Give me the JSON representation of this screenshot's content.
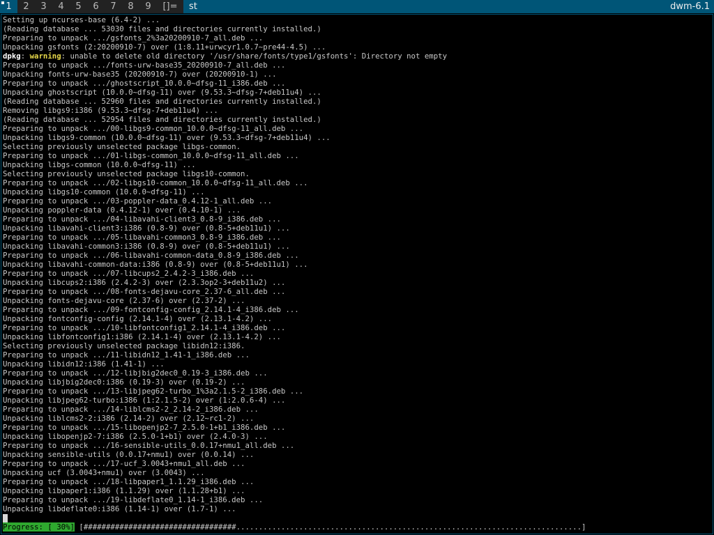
{
  "bar": {
    "tags": [
      "1",
      "2",
      "3",
      "4",
      "5",
      "6",
      "7",
      "8",
      "9"
    ],
    "selected_tag": 0,
    "layout_symbol": "[]=",
    "window_title": "st",
    "status_text": "dwm-6.1"
  },
  "terminal": {
    "lines": [
      {
        "text": "Setting up ncurses-base (6.4-2) ..."
      },
      {
        "text": "(Reading database ... 53030 files and directories currently installed.)"
      },
      {
        "text": "Preparing to unpack .../gsfonts_2%3a20200910-7_all.deb ..."
      },
      {
        "text": "Unpacking gsfonts (2:20200910-7) over (1:8.11+urwcyr1.0.7~pre44-4.5) ..."
      },
      {
        "text": ": unable to delete old directory '/usr/share/fonts/type1/gsfonts': Directory not empty",
        "prefix": "dpkg",
        "warn": "warning"
      },
      {
        "text": "Preparing to unpack .../fonts-urw-base35_20200910-7_all.deb ..."
      },
      {
        "text": "Unpacking fonts-urw-base35 (20200910-7) over (20200910-1) ..."
      },
      {
        "text": "Preparing to unpack .../ghostscript_10.0.0~dfsg-11_i386.deb ..."
      },
      {
        "text": "Unpacking ghostscript (10.0.0~dfsg-11) over (9.53.3~dfsg-7+deb11u4) ..."
      },
      {
        "text": "(Reading database ... 52960 files and directories currently installed.)"
      },
      {
        "text": "Removing libgs9:i386 (9.53.3~dfsg-7+deb11u4) ..."
      },
      {
        "text": "(Reading database ... 52954 files and directories currently installed.)"
      },
      {
        "text": "Preparing to unpack .../00-libgs9-common_10.0.0~dfsg-11_all.deb ..."
      },
      {
        "text": "Unpacking libgs9-common (10.0.0~dfsg-11) over (9.53.3~dfsg-7+deb11u4) ..."
      },
      {
        "text": "Selecting previously unselected package libgs-common."
      },
      {
        "text": "Preparing to unpack .../01-libgs-common_10.0.0~dfsg-11_all.deb ..."
      },
      {
        "text": "Unpacking libgs-common (10.0.0~dfsg-11) ..."
      },
      {
        "text": "Selecting previously unselected package libgs10-common."
      },
      {
        "text": "Preparing to unpack .../02-libgs10-common_10.0.0~dfsg-11_all.deb ..."
      },
      {
        "text": "Unpacking libgs10-common (10.0.0~dfsg-11) ..."
      },
      {
        "text": "Preparing to unpack .../03-poppler-data_0.4.12-1_all.deb ..."
      },
      {
        "text": "Unpacking poppler-data (0.4.12-1) over (0.4.10-1) ..."
      },
      {
        "text": "Preparing to unpack .../04-libavahi-client3_0.8-9_i386.deb ..."
      },
      {
        "text": "Unpacking libavahi-client3:i386 (0.8-9) over (0.8-5+deb11u1) ..."
      },
      {
        "text": "Preparing to unpack .../05-libavahi-common3_0.8-9_i386.deb ..."
      },
      {
        "text": "Unpacking libavahi-common3:i386 (0.8-9) over (0.8-5+deb11u1) ..."
      },
      {
        "text": "Preparing to unpack .../06-libavahi-common-data_0.8-9_i386.deb ..."
      },
      {
        "text": "Unpacking libavahi-common-data:i386 (0.8-9) over (0.8-5+deb11u1) ..."
      },
      {
        "text": "Preparing to unpack .../07-libcups2_2.4.2-3_i386.deb ..."
      },
      {
        "text": "Unpacking libcups2:i386 (2.4.2-3) over (2.3.3op2-3+deb11u2) ..."
      },
      {
        "text": "Preparing to unpack .../08-fonts-dejavu-core_2.37-6_all.deb ..."
      },
      {
        "text": "Unpacking fonts-dejavu-core (2.37-6) over (2.37-2) ..."
      },
      {
        "text": "Preparing to unpack .../09-fontconfig-config_2.14.1-4_i386.deb ..."
      },
      {
        "text": "Unpacking fontconfig-config (2.14.1-4) over (2.13.1-4.2) ..."
      },
      {
        "text": "Preparing to unpack .../10-libfontconfig1_2.14.1-4_i386.deb ..."
      },
      {
        "text": "Unpacking libfontconfig1:i386 (2.14.1-4) over (2.13.1-4.2) ..."
      },
      {
        "text": "Selecting previously unselected package libidn12:i386."
      },
      {
        "text": "Preparing to unpack .../11-libidn12_1.41-1_i386.deb ..."
      },
      {
        "text": "Unpacking libidn12:i386 (1.41-1) ..."
      },
      {
        "text": "Preparing to unpack .../12-libjbig2dec0_0.19-3_i386.deb ..."
      },
      {
        "text": "Unpacking libjbig2dec0:i386 (0.19-3) over (0.19-2) ..."
      },
      {
        "text": "Preparing to unpack .../13-libjpeg62-turbo_1%3a2.1.5-2_i386.deb ..."
      },
      {
        "text": "Unpacking libjpeg62-turbo:i386 (1:2.1.5-2) over (1:2.0.6-4) ..."
      },
      {
        "text": "Preparing to unpack .../14-liblcms2-2_2.14-2_i386.deb ..."
      },
      {
        "text": "Unpacking liblcms2-2:i386 (2.14-2) over (2.12~rc1-2) ..."
      },
      {
        "text": "Preparing to unpack .../15-libopenjp2-7_2.5.0-1+b1_i386.deb ..."
      },
      {
        "text": "Unpacking libopenjp2-7:i386 (2.5.0-1+b1) over (2.4.0-3) ..."
      },
      {
        "text": "Preparing to unpack .../16-sensible-utils_0.0.17+nmu1_all.deb ..."
      },
      {
        "text": "Unpacking sensible-utils (0.0.17+nmu1) over (0.0.14) ..."
      },
      {
        "text": "Preparing to unpack .../17-ucf_3.0043+nmu1_all.deb ..."
      },
      {
        "text": "Unpacking ucf (3.0043+nmu1) over (3.0043) ..."
      },
      {
        "text": "Preparing to unpack .../18-libpaper1_1.1.29_i386.deb ..."
      },
      {
        "text": "Unpacking libpaper1:i386 (1.1.29) over (1.1.28+b1) ..."
      },
      {
        "text": "Preparing to unpack .../19-libdeflate0_1.14-1_i386.deb ..."
      },
      {
        "text": "Unpacking libdeflate0:i386 (1.14-1) over (1.7-1) ..."
      }
    ],
    "progress": {
      "label": "Progress: [ 30%]",
      "percent": 30,
      "bar": " [##################################.............................................................................]"
    }
  }
}
